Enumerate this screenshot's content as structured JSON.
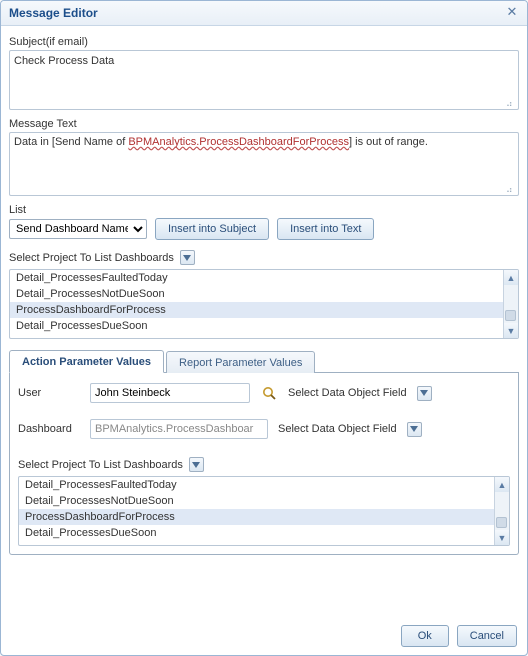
{
  "dialog": {
    "title": "Message Editor"
  },
  "subject": {
    "label": "Subject(if email)",
    "value": "Check Process Data"
  },
  "message": {
    "label": "Message Text",
    "pre": "Data in [Send Name of ",
    "red": "BPMAnalytics.ProcessDashboardForProcess",
    "post": "] is out of range."
  },
  "list": {
    "label": "List",
    "selected": "Send Dashboard Name",
    "insert_subject": "Insert into Subject",
    "insert_text": "Insert into Text"
  },
  "project_label": "Select Project To List Dashboards",
  "dash_items": [
    "Detail_ProcessesFaultedToday",
    "Detail_ProcessesNotDueSoon",
    "ProcessDashboardForProcess",
    "Detail_ProcessesDueSoon"
  ],
  "dash_selected_index": 2,
  "tabs": {
    "active": "Action Parameter Values",
    "other": "Report Parameter Values"
  },
  "param": {
    "user_label": "User",
    "user_value": "John Steinbeck",
    "sdo_label": "Select Data Object Field",
    "dash_label": "Dashboard",
    "dash_value": "BPMAnalytics.ProcessDashboar"
  },
  "buttons": {
    "ok": "Ok",
    "cancel": "Cancel"
  }
}
